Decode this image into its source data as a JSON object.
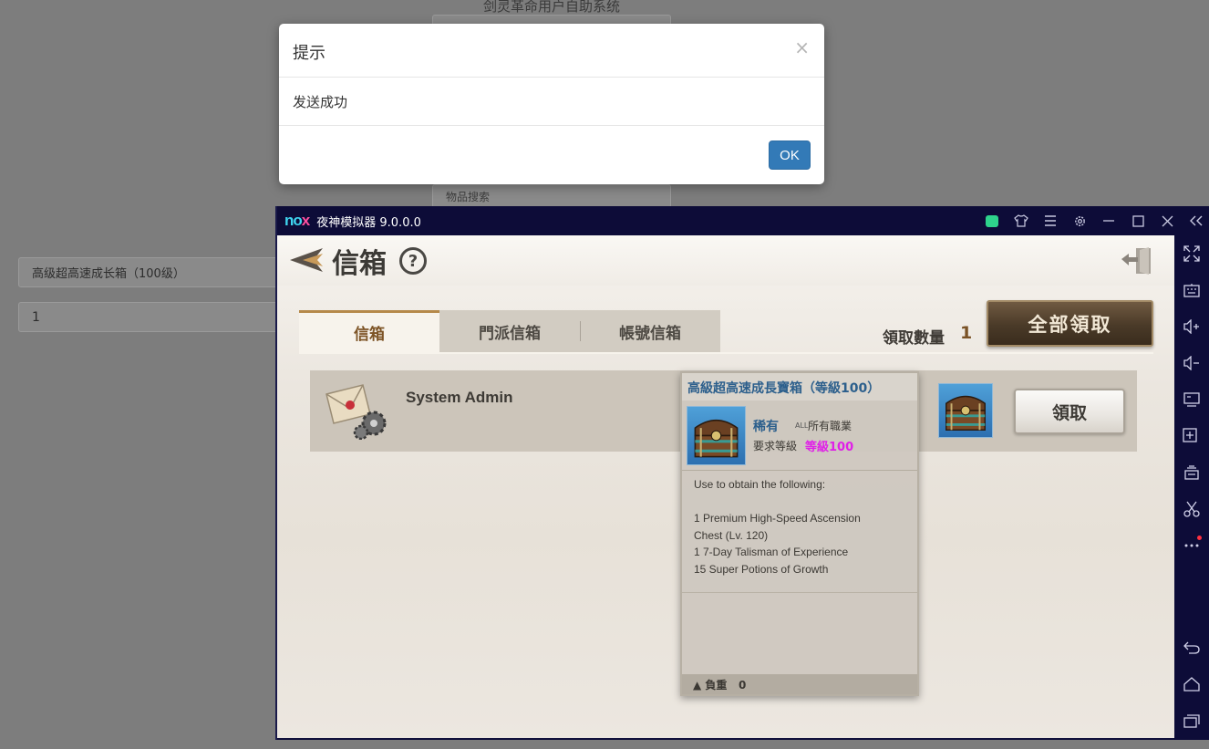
{
  "background": {
    "title": "剑灵革命用户自助系统",
    "search_placeholder": "物品搜索",
    "item_select_value": "高级超高速成长箱（100级）",
    "quantity_value": "1"
  },
  "modal": {
    "title": "提示",
    "close_glyph": "×",
    "message": "发送成功",
    "ok_label": "OK"
  },
  "emulator": {
    "brand_no": "no",
    "brand_x": "x",
    "title": "夜神模拟器 9.0.0.0"
  },
  "game": {
    "title": "信箱",
    "help_glyph": "?",
    "tabs": [
      {
        "label": "信箱"
      },
      {
        "label": "門派信箱"
      },
      {
        "label": "帳號信箱"
      }
    ],
    "claim_count_label": "領取數量",
    "claim_count": "1",
    "claim_all_label": "全部領取",
    "mail": {
      "sender": "System Admin",
      "claim_label": "領取"
    },
    "tooltip": {
      "name": "高級超高速成長寶箱（等級100）",
      "rarity": "稀有",
      "all_tag": "ALL",
      "class": "所有職業",
      "req_label": "要求等級",
      "req_level": "等級100",
      "desc": [
        "Use to obtain the following:",
        "",
        "1 Premium High-Speed Ascension",
        "Chest (Lv. 120)",
        "1 7-Day Talisman of Experience",
        "15 Super Potions of Growth"
      ],
      "weight_label": "負重",
      "weight_value": "0"
    }
  },
  "colors": {
    "ok_button": "#337ab7",
    "emulator_bar": "#0d0c38",
    "rarity_text": "#2c5f8c",
    "level_text": "#e020e8",
    "tab_active_text": "#7d5426"
  }
}
